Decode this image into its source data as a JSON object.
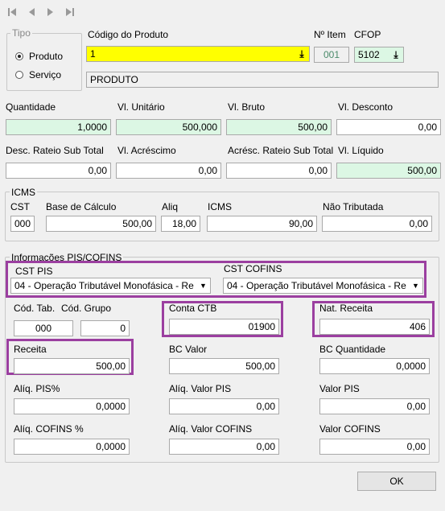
{
  "nav": {
    "first": "first-record",
    "prev": "previous-record",
    "next": "next-record",
    "last": "last-record"
  },
  "tipo": {
    "title": "Tipo",
    "options": [
      {
        "label": "Produto",
        "selected": true
      },
      {
        "label": "Serviço",
        "selected": false
      }
    ]
  },
  "produto": {
    "codigo_label": "Código do Produto",
    "codigo_value": "1",
    "descricao": "PRODUTO",
    "item_label": "Nº Item",
    "item_value": "001",
    "cfop_label": "CFOP",
    "cfop_value": "5102"
  },
  "valores": {
    "quantidade_label": "Quantidade",
    "quantidade": "1,0000",
    "vl_unitario_label": "Vl. Unitário",
    "vl_unitario": "500,000",
    "vl_bruto_label": "Vl. Bruto",
    "vl_bruto": "500,00",
    "vl_desconto_label": "Vl. Desconto",
    "vl_desconto": "0,00",
    "desc_rateio_label": "Desc. Rateio Sub Total",
    "desc_rateio": "0,00",
    "vl_acrescimo_label": "Vl. Acréscimo",
    "vl_acrescimo": "0,00",
    "acresc_rateio_label": "Acrésc. Rateio Sub Total",
    "acresc_rateio": "0,00",
    "vl_liquido_label": "Vl. Líquido",
    "vl_liquido": "500,00"
  },
  "icms": {
    "title": "ICMS",
    "cst_label": "CST",
    "cst": "000",
    "base_label": "Base de Cálculo",
    "base": "500,00",
    "aliq_label": "Aliq",
    "aliq": "18,00",
    "icms_label": "ICMS",
    "icms": "90,00",
    "nao_trib_label": "Não Tributada",
    "nao_trib": "0,00"
  },
  "pis_cofins": {
    "title": "Informações PIS/COFINS",
    "cst_pis_label": "CST PIS",
    "cst_pis": "04 - Operação Tributável Monofásica - Re",
    "cst_cofins_label": "CST COFINS",
    "cst_cofins": "04 - Operação Tributável Monofásica - Re",
    "cod_tab_label": "Cód. Tab.",
    "cod_tab": "000",
    "cod_grupo_label": "Cód. Grupo",
    "cod_grupo": "0",
    "conta_ctb_label": "Conta CTB",
    "conta_ctb": "01900",
    "nat_receita_label": "Nat. Receita",
    "nat_receita": "406",
    "receita_label": "Receita",
    "receita": "500,00",
    "bc_valor_label": "BC Valor",
    "bc_valor": "500,00",
    "bc_qtd_label": "BC Quantidade",
    "bc_qtd": "0,0000",
    "aliq_pis_label": "Alíq. PIS%",
    "aliq_pis": "0,0000",
    "aliq_valor_pis_label": "Alíq. Valor PIS",
    "aliq_valor_pis": "0,00",
    "valor_pis_label": "Valor PIS",
    "valor_pis": "0,00",
    "aliq_cofins_label": "Alíq. COFINS %",
    "aliq_cofins": "0,0000",
    "aliq_valor_cofins_label": "Alíq. Valor COFINS",
    "aliq_valor_cofins": "0,00",
    "valor_cofins_label": "Valor COFINS",
    "valor_cofins": "0,00"
  },
  "ok_label": "OK",
  "colors": {
    "highlight": "#9b3fa0",
    "readonly_green": "#dcf7e4",
    "required_yellow": "#ffff00"
  }
}
